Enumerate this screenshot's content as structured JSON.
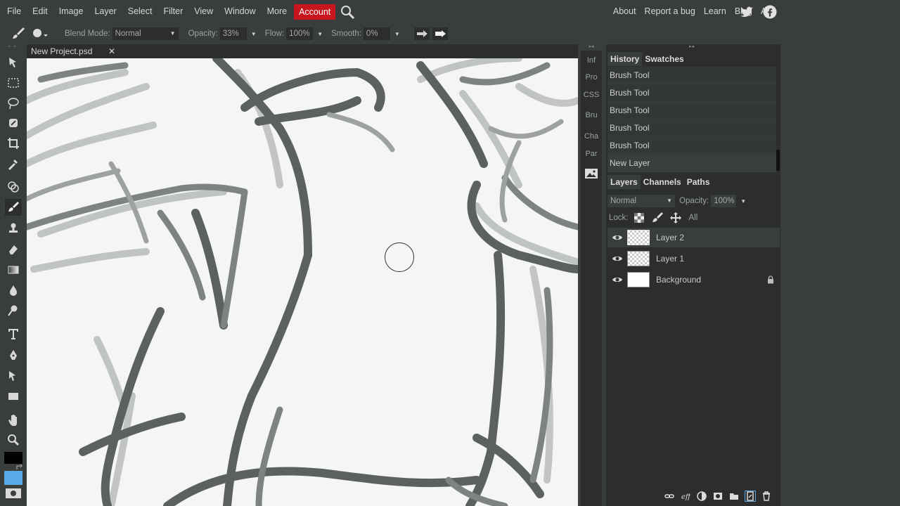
{
  "menu": {
    "items": [
      "File",
      "Edit",
      "Image",
      "Layer",
      "Select",
      "Filter",
      "View",
      "Window",
      "More"
    ],
    "account": "Account",
    "right_links": [
      "About",
      "Report a bug",
      "Learn",
      "Blog",
      "API"
    ],
    "social_icons": [
      "twitter-icon",
      "facebook-icon"
    ]
  },
  "options": {
    "blend_mode_label": "Blend Mode:",
    "blend_mode_value": "Normal",
    "opacity_label": "Opacity:",
    "opacity_value": "33%",
    "flow_label": "Flow:",
    "flow_value": "100%",
    "smooth_label": "Smooth:",
    "smooth_value": "0%"
  },
  "document": {
    "tab_title": "New Project.psd",
    "close_glyph": "✕"
  },
  "mini_panel": {
    "items": [
      "Inf",
      "Pro",
      "CSS",
      "Bru",
      "Cha",
      "Par"
    ]
  },
  "history_panel": {
    "tabs": [
      "History",
      "Swatches"
    ],
    "steps": [
      "Brush Tool",
      "Brush Tool",
      "Brush Tool",
      "Brush Tool",
      "Brush Tool",
      "New Layer"
    ]
  },
  "layers_panel": {
    "tabs": [
      "Layers",
      "Channels",
      "Paths"
    ],
    "blend_mode": "Normal",
    "opacity_label": "Opacity:",
    "opacity_value": "100%",
    "lock_label": "Lock:",
    "lock_all": "All",
    "layers": [
      {
        "name": "Layer 2",
        "selected": true
      },
      {
        "name": "Layer 1",
        "selected": false
      },
      {
        "name": "Background",
        "selected": false,
        "locked": true
      }
    ]
  },
  "colors": {
    "accent": "#c8141c",
    "panel_bg": "#2b2d2e",
    "ui_bg": "#3a3d3e",
    "canvas_bg": "#f4f5f4",
    "foreground_color": "#000000",
    "background_color": "#5aa9e6"
  }
}
